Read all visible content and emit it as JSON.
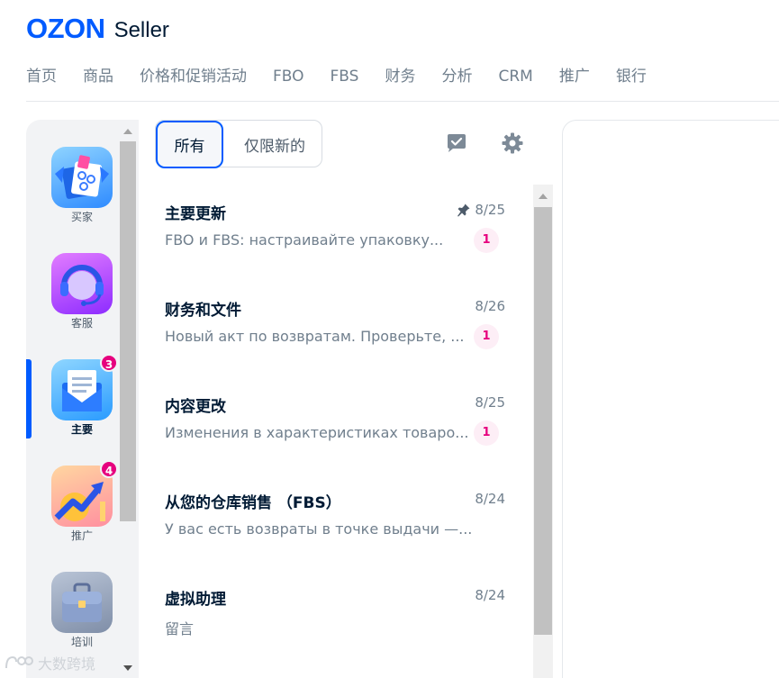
{
  "brand": {
    "name": "OZON",
    "product": "Seller",
    "color": "#005bff"
  },
  "topnav": [
    "首页",
    "商品",
    "价格和促销活动",
    "FBO",
    "FBS",
    "财务",
    "分析",
    "CRM",
    "推广",
    "银行"
  ],
  "rail": [
    {
      "label": "买家",
      "icon": "shopping-bags-icon",
      "badge": null,
      "active": false
    },
    {
      "label": "客服",
      "icon": "headset-icon",
      "badge": null,
      "active": false
    },
    {
      "label": "主要",
      "icon": "envelope-icon",
      "badge": "3",
      "active": true
    },
    {
      "label": "推广",
      "icon": "growth-arrow-icon",
      "badge": "4",
      "active": false
    },
    {
      "label": "培训",
      "icon": "briefcase-icon",
      "badge": null,
      "active": false
    }
  ],
  "filter": {
    "all": "所有",
    "unread": "仅限新的",
    "selected": "all"
  },
  "messages": [
    {
      "title": "主要更新",
      "date": "8/25",
      "pinned": true,
      "preview": "FBO и FBS: настраивайте упаковку...",
      "count": "1"
    },
    {
      "title": "财务和文件",
      "date": "8/26",
      "pinned": false,
      "preview": "Новый акт по возвратам. Проверьте, ...",
      "count": "1"
    },
    {
      "title": "内容更改",
      "date": "8/25",
      "pinned": false,
      "preview": "Изменения в характеристиках товаро...",
      "count": "1"
    },
    {
      "title": "从您的仓库销售 （FBS）",
      "date": "8/24",
      "pinned": false,
      "preview": "У вас есть возвраты в точке выдачи —...",
      "count": null
    },
    {
      "title": "虚拟助理",
      "date": "8/24",
      "pinned": false,
      "preview": "留言",
      "count": null
    }
  ],
  "watermark": "大数跨境",
  "colors": {
    "accent": "#005bff",
    "badge": "#e6007e",
    "muted": "#707f8d"
  }
}
